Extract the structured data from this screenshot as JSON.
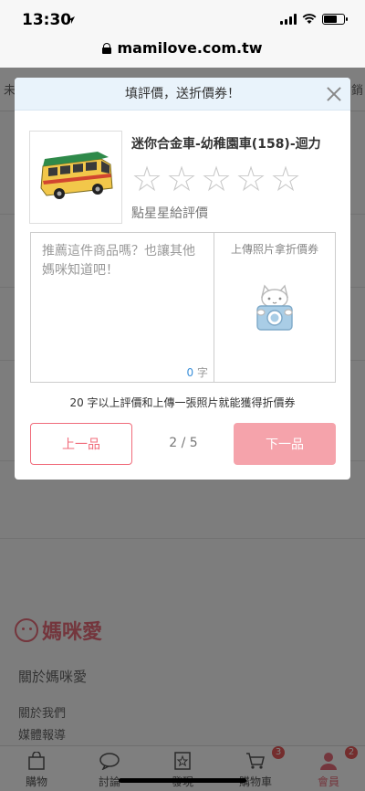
{
  "status": {
    "time": "13:30"
  },
  "browser": {
    "url": "mamilove.com.tw"
  },
  "background": {
    "left_tab_fragment": "未",
    "right_tab_fragment": "銷",
    "logo_text": "媽咪愛",
    "about_title": "關於媽咪愛",
    "links": [
      "關於我們",
      "媒體報導"
    ]
  },
  "bottom_nav": {
    "items": [
      {
        "label": "購物",
        "icon": "bag-icon",
        "badge": ""
      },
      {
        "label": "討論",
        "icon": "chat-icon",
        "badge": ""
      },
      {
        "label": "發現",
        "icon": "discover-icon",
        "badge": ""
      },
      {
        "label": "購物車",
        "icon": "cart-icon",
        "badge": "3"
      },
      {
        "label": "會員",
        "icon": "member-icon",
        "badge": "2"
      }
    ]
  },
  "modal": {
    "title": "填評價，送折價券！",
    "product_name": "迷你合金車-幼稚園車(158)-迴力",
    "rating": 0,
    "rating_max": 5,
    "rating_hint": "點星星給評價",
    "review_placeholder": "推薦這件商品嗎？也讓其他媽咪知道吧！",
    "char_count": "0",
    "char_unit": "字",
    "upload_label": "上傳照片拿折價券",
    "notice": "20 字以上評價和上傳一張照片就能獲得折價券",
    "prev_label": "上一品",
    "pager": "2 / 5",
    "next_label": "下一品"
  },
  "colors": {
    "accent": "#f06b7a",
    "header_bg": "#e9f3fb",
    "next_button": "#f5a3ab"
  }
}
